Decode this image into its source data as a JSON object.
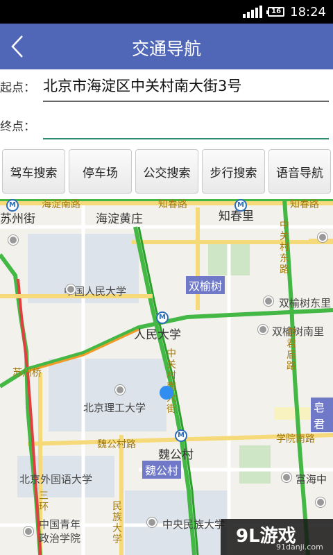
{
  "status_bar": {
    "time": "18:24",
    "battery": "16"
  },
  "header": {
    "title": "交通导航",
    "back_icon": "chevron-left-icon"
  },
  "form": {
    "start_label": "起点：",
    "start_value": "北京市海淀区中关村南大街3号",
    "end_label": "终点：",
    "end_value": ""
  },
  "buttons": [
    "驾车搜索",
    "停车场",
    "公交搜索",
    "步行搜索",
    "语音导航"
  ],
  "map": {
    "places": [
      "苏州街",
      "海淀黄庄",
      "知春里",
      "中国人民大学",
      "人民大学",
      "北京理工大学",
      "魏公村",
      "北京外国语大学",
      "中国青年",
      "政治学院",
      "中央民族大学",
      "双榆树东里",
      "双榆树南里",
      "富海中"
    ],
    "roads": [
      "海淀南路",
      "知春路",
      "知春路",
      "中关村东路",
      "皂君庙路",
      "苏州桥",
      "魏公村路",
      "学院南路",
      "三环",
      "民族大学"
    ],
    "district_badges": [
      "双榆树",
      "魏公村",
      "皂君"
    ],
    "road_v1": "中关村南大街",
    "road_v2": "中关村东路",
    "road_v3": "皂君庙路",
    "road_v4": "民族大学",
    "road_v5": "三环"
  },
  "watermark": {
    "logo": "9L游戏",
    "url": "91danji.com"
  }
}
